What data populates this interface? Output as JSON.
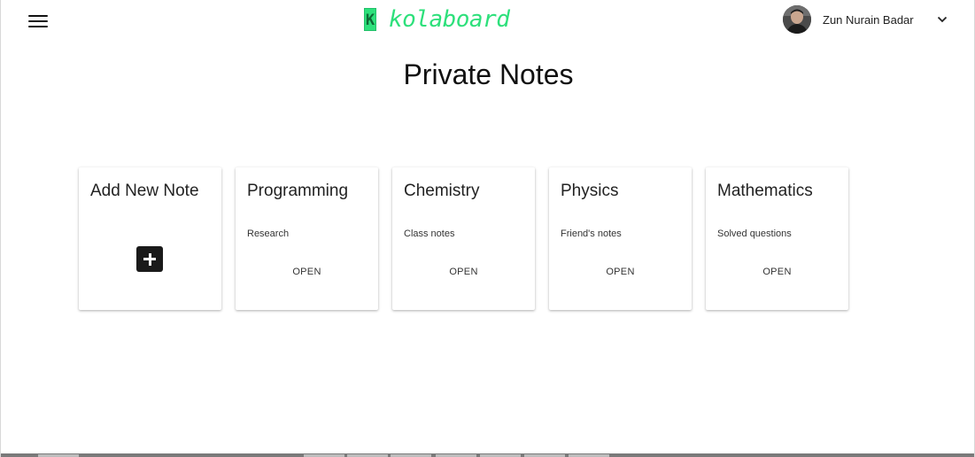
{
  "header": {
    "logo_mark": "K",
    "logo_text": "kolaboard",
    "user_name": "Zun Nurain Badar"
  },
  "main": {
    "title": "Private Notes",
    "add_card": {
      "title": "Add New Note"
    },
    "notes": [
      {
        "title": "Programming",
        "subtitle": "Research",
        "action": "OPEN"
      },
      {
        "title": "Chemistry",
        "subtitle": "Class notes",
        "action": "OPEN"
      },
      {
        "title": "Physics",
        "subtitle": "Friend's notes",
        "action": "OPEN"
      },
      {
        "title": "Mathematics",
        "subtitle": "Solved questions",
        "action": "OPEN"
      }
    ]
  },
  "icons": {
    "menu": "hamburger-icon",
    "expand": "chevron-down-icon",
    "add": "plus-icon"
  },
  "colors": {
    "brand": "#2de07b",
    "text": "#212121",
    "add_button": "#1a1a1a"
  }
}
